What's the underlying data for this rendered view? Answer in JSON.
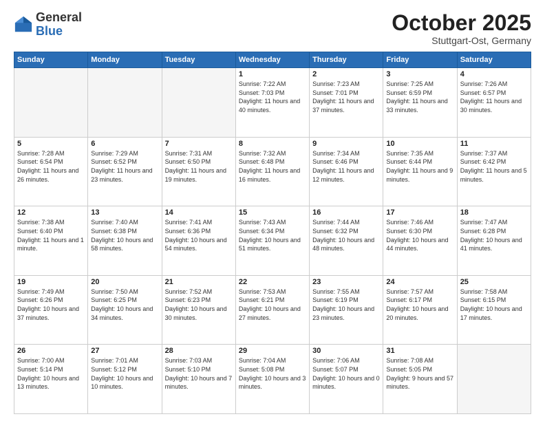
{
  "header": {
    "logo_general": "General",
    "logo_blue": "Blue",
    "month": "October 2025",
    "location": "Stuttgart-Ost, Germany"
  },
  "weekdays": [
    "Sunday",
    "Monday",
    "Tuesday",
    "Wednesday",
    "Thursday",
    "Friday",
    "Saturday"
  ],
  "weeks": [
    [
      {
        "day": "",
        "info": ""
      },
      {
        "day": "",
        "info": ""
      },
      {
        "day": "",
        "info": ""
      },
      {
        "day": "1",
        "info": "Sunrise: 7:22 AM\nSunset: 7:03 PM\nDaylight: 11 hours and 40 minutes."
      },
      {
        "day": "2",
        "info": "Sunrise: 7:23 AM\nSunset: 7:01 PM\nDaylight: 11 hours and 37 minutes."
      },
      {
        "day": "3",
        "info": "Sunrise: 7:25 AM\nSunset: 6:59 PM\nDaylight: 11 hours and 33 minutes."
      },
      {
        "day": "4",
        "info": "Sunrise: 7:26 AM\nSunset: 6:57 PM\nDaylight: 11 hours and 30 minutes."
      }
    ],
    [
      {
        "day": "5",
        "info": "Sunrise: 7:28 AM\nSunset: 6:54 PM\nDaylight: 11 hours and 26 minutes."
      },
      {
        "day": "6",
        "info": "Sunrise: 7:29 AM\nSunset: 6:52 PM\nDaylight: 11 hours and 23 minutes."
      },
      {
        "day": "7",
        "info": "Sunrise: 7:31 AM\nSunset: 6:50 PM\nDaylight: 11 hours and 19 minutes."
      },
      {
        "day": "8",
        "info": "Sunrise: 7:32 AM\nSunset: 6:48 PM\nDaylight: 11 hours and 16 minutes."
      },
      {
        "day": "9",
        "info": "Sunrise: 7:34 AM\nSunset: 6:46 PM\nDaylight: 11 hours and 12 minutes."
      },
      {
        "day": "10",
        "info": "Sunrise: 7:35 AM\nSunset: 6:44 PM\nDaylight: 11 hours and 9 minutes."
      },
      {
        "day": "11",
        "info": "Sunrise: 7:37 AM\nSunset: 6:42 PM\nDaylight: 11 hours and 5 minutes."
      }
    ],
    [
      {
        "day": "12",
        "info": "Sunrise: 7:38 AM\nSunset: 6:40 PM\nDaylight: 11 hours and 1 minute."
      },
      {
        "day": "13",
        "info": "Sunrise: 7:40 AM\nSunset: 6:38 PM\nDaylight: 10 hours and 58 minutes."
      },
      {
        "day": "14",
        "info": "Sunrise: 7:41 AM\nSunset: 6:36 PM\nDaylight: 10 hours and 54 minutes."
      },
      {
        "day": "15",
        "info": "Sunrise: 7:43 AM\nSunset: 6:34 PM\nDaylight: 10 hours and 51 minutes."
      },
      {
        "day": "16",
        "info": "Sunrise: 7:44 AM\nSunset: 6:32 PM\nDaylight: 10 hours and 48 minutes."
      },
      {
        "day": "17",
        "info": "Sunrise: 7:46 AM\nSunset: 6:30 PM\nDaylight: 10 hours and 44 minutes."
      },
      {
        "day": "18",
        "info": "Sunrise: 7:47 AM\nSunset: 6:28 PM\nDaylight: 10 hours and 41 minutes."
      }
    ],
    [
      {
        "day": "19",
        "info": "Sunrise: 7:49 AM\nSunset: 6:26 PM\nDaylight: 10 hours and 37 minutes."
      },
      {
        "day": "20",
        "info": "Sunrise: 7:50 AM\nSunset: 6:25 PM\nDaylight: 10 hours and 34 minutes."
      },
      {
        "day": "21",
        "info": "Sunrise: 7:52 AM\nSunset: 6:23 PM\nDaylight: 10 hours and 30 minutes."
      },
      {
        "day": "22",
        "info": "Sunrise: 7:53 AM\nSunset: 6:21 PM\nDaylight: 10 hours and 27 minutes."
      },
      {
        "day": "23",
        "info": "Sunrise: 7:55 AM\nSunset: 6:19 PM\nDaylight: 10 hours and 23 minutes."
      },
      {
        "day": "24",
        "info": "Sunrise: 7:57 AM\nSunset: 6:17 PM\nDaylight: 10 hours and 20 minutes."
      },
      {
        "day": "25",
        "info": "Sunrise: 7:58 AM\nSunset: 6:15 PM\nDaylight: 10 hours and 17 minutes."
      }
    ],
    [
      {
        "day": "26",
        "info": "Sunrise: 7:00 AM\nSunset: 5:14 PM\nDaylight: 10 hours and 13 minutes."
      },
      {
        "day": "27",
        "info": "Sunrise: 7:01 AM\nSunset: 5:12 PM\nDaylight: 10 hours and 10 minutes."
      },
      {
        "day": "28",
        "info": "Sunrise: 7:03 AM\nSunset: 5:10 PM\nDaylight: 10 hours and 7 minutes."
      },
      {
        "day": "29",
        "info": "Sunrise: 7:04 AM\nSunset: 5:08 PM\nDaylight: 10 hours and 3 minutes."
      },
      {
        "day": "30",
        "info": "Sunrise: 7:06 AM\nSunset: 5:07 PM\nDaylight: 10 hours and 0 minutes."
      },
      {
        "day": "31",
        "info": "Sunrise: 7:08 AM\nSunset: 5:05 PM\nDaylight: 9 hours and 57 minutes."
      },
      {
        "day": "",
        "info": ""
      }
    ]
  ]
}
